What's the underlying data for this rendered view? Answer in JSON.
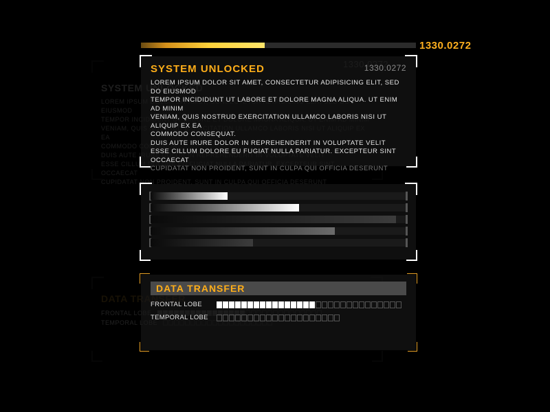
{
  "topbar": {
    "fill_pct": 45,
    "value": "1330.0272"
  },
  "panel1": {
    "title": "SYSTEM UNLOCKED",
    "value": "1330.0272",
    "body_lines": [
      "LOREM IPSUM DOLOR SIT AMET, CONSECTETUR ADIPISICING ELIT, SED DO EIUSMOD",
      "TEMPOR INCIDIDUNT UT LABORE ET DOLORE MAGNA ALIQUA. UT ENIM AD MINIM",
      "VENIAM, QUIS NOSTRUD EXERCITATION ULLAMCO LABORIS NISI UT ALIQUIP EX EA",
      "COMMODO CONSEQUAT.",
      "DUIS AUTE IRURE DOLOR IN REPREHENDERIT IN VOLUPTATE VELIT",
      "ESSE CILLUM DOLORE EU FUGIAT NULLA PARIATUR. EXCEPTEUR SINT OCCAECAT"
    ],
    "body_dim_tail": "CUPIDATAT NON PROIDENT, SUNT IN CULPA QUI OFFICIA DESERUNT"
  },
  "panel2": {
    "bars": [
      {
        "pct": 30,
        "style": "lt"
      },
      {
        "pct": 58,
        "style": "lt"
      },
      {
        "pct": 96,
        "style": "dk"
      },
      {
        "pct": 72,
        "style": "md"
      },
      {
        "pct": 40,
        "style": "dk"
      }
    ]
  },
  "panel3": {
    "title": "DATA TRANSFER",
    "rows": [
      {
        "label": "FRONTAL LOBE",
        "filled": 16,
        "total": 30
      },
      {
        "label": "TEMPORAL LOBE",
        "filled": 0,
        "total": 20
      }
    ]
  },
  "colors": {
    "accent": "#ffae19"
  }
}
